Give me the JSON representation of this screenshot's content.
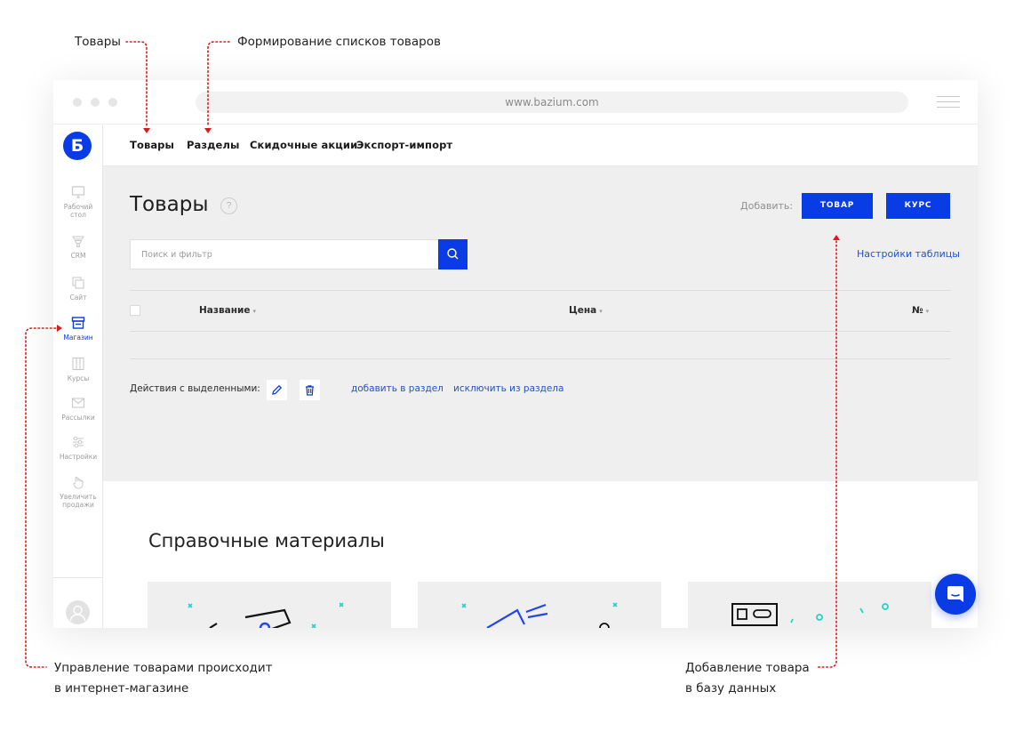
{
  "annotations": {
    "products": "Товары",
    "lists": "Формирование списков товаров",
    "shop_line1": "Управление товарами происходит",
    "shop_line2": "в интернет-магазине",
    "add_line1": "Добавление товара",
    "add_line2": "в базу данных",
    "accent_color": "#d91a1a"
  },
  "browser": {
    "url": "www.bazium.com"
  },
  "logo": {
    "letter": "Б"
  },
  "sidebar": {
    "items": [
      {
        "label1": "Рабочий",
        "label2": "стол",
        "icon": "monitor-icon"
      },
      {
        "label1": "CRM",
        "label2": "",
        "icon": "funnel-icon"
      },
      {
        "label1": "Сайт",
        "label2": "",
        "icon": "pages-icon"
      },
      {
        "label1": "Магазин",
        "label2": "",
        "icon": "store-icon",
        "active": true
      },
      {
        "label1": "Курсы",
        "label2": "",
        "icon": "books-icon"
      },
      {
        "label1": "Рассылки",
        "label2": "",
        "icon": "mail-icon"
      },
      {
        "label1": "Настройки",
        "label2": "",
        "icon": "sliders-icon"
      },
      {
        "label1": "Увеличить",
        "label2": "продажи",
        "icon": "hand-icon"
      }
    ]
  },
  "nav": {
    "items": [
      "Товары",
      "Разделы",
      "Скидочные акции",
      "Экспорт-импорт"
    ]
  },
  "page": {
    "title": "Товары",
    "help": "?",
    "add_label": "Добавить:",
    "btn_product": "ТОВАР",
    "btn_course": "КУРС",
    "search_placeholder": "Поиск и фильтр",
    "table_settings": "Настройки таблицы",
    "columns": {
      "name": "Название",
      "price": "Цена",
      "num": "№"
    },
    "sort_glyph": "▾",
    "actions_label": "Действия с выделенными:",
    "link_add": "добавить в раздел",
    "link_remove": "исключить из раздела"
  },
  "reference": {
    "title": "Справочные материалы"
  },
  "colors": {
    "brand": "#0a3ce6",
    "link": "#1f54c8",
    "content_bg": "#efefef",
    "card_accent": "#1fd3c9"
  }
}
